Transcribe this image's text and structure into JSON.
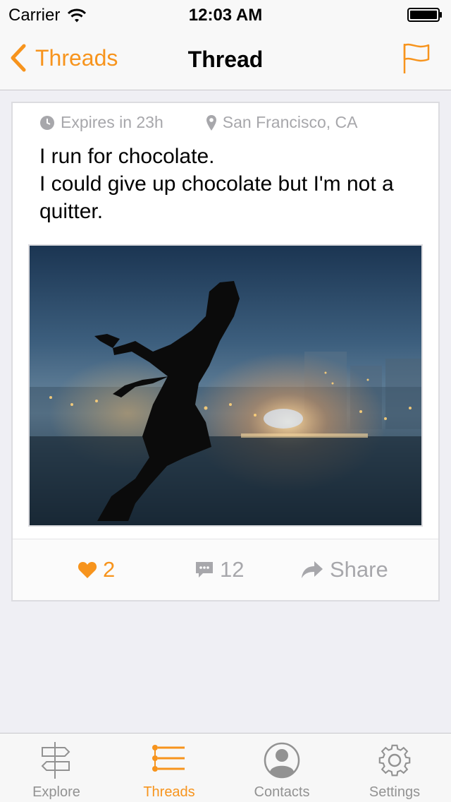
{
  "status_bar": {
    "carrier": "Carrier",
    "time": "12:03 AM"
  },
  "nav": {
    "back_label": "Threads",
    "title": "Thread"
  },
  "post": {
    "expires": "Expires in 23h",
    "location": "San Francisco, CA",
    "text": "I run for chocolate.\nI could give up chocolate but I'm not a quitter.",
    "likes": "2",
    "comments": "12",
    "share_label": "Share"
  },
  "tabs": [
    {
      "label": "Explore",
      "icon": "signpost-icon",
      "active": false
    },
    {
      "label": "Threads",
      "icon": "list-icon",
      "active": true
    },
    {
      "label": "Contacts",
      "icon": "person-icon",
      "active": false
    },
    {
      "label": "Settings",
      "icon": "gear-icon",
      "active": false
    }
  ],
  "colors": {
    "accent": "#f7941d",
    "muted": "#a7a7ab",
    "background": "#efeff4"
  }
}
